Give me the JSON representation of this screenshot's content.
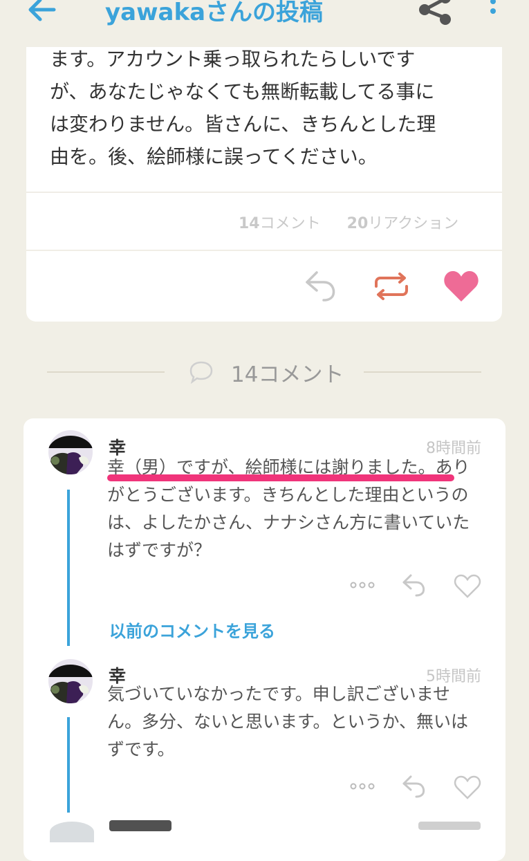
{
  "header": {
    "title": "yawakaさんの投稿",
    "icons": {
      "back": "back-arrow-icon",
      "share": "share-icon",
      "more": "more-vertical-icon"
    }
  },
  "post": {
    "text_lines": [
      "ます。アカウント乗っ取られたらしいです",
      "が、あなたじゃなくても無断転載してる事に",
      "は変わりません。皆さんに、きちんとした理",
      "由を。後、絵師様に誤ってください。"
    ],
    "comment_count_num": "14",
    "comment_count_unit": "コメント",
    "reaction_count_num": "20",
    "reaction_count_unit": "リアクション",
    "actions": {
      "reply": "reply-icon",
      "repost": "repost-icon",
      "like": "heart-icon"
    }
  },
  "comments_header": {
    "label": "14コメント",
    "icon": "comment-bubble-icon"
  },
  "comments": [
    {
      "name": "幸",
      "time": "8時間前",
      "text_lines": [
        "幸（男）ですが、絵師様には謝りました。あり",
        "がとうございます。きちんとした理由というの",
        "は、よしたかさん、ナナシさん方に書いていた",
        "はずですが？"
      ]
    },
    {
      "name": "幸",
      "time": "5時間前",
      "text_lines": [
        "気づいていなかったです。申し訳ございませ",
        "ん。多分、ないと思います。というか、無いは",
        "ずです。"
      ]
    }
  ],
  "see_previous": "以前のコメントを見る",
  "colors": {
    "accent": "#3ba3da",
    "repost": "#e0745a",
    "heart": "#ee6b96",
    "underline": "#f0347a",
    "background": "#f1efe6"
  }
}
